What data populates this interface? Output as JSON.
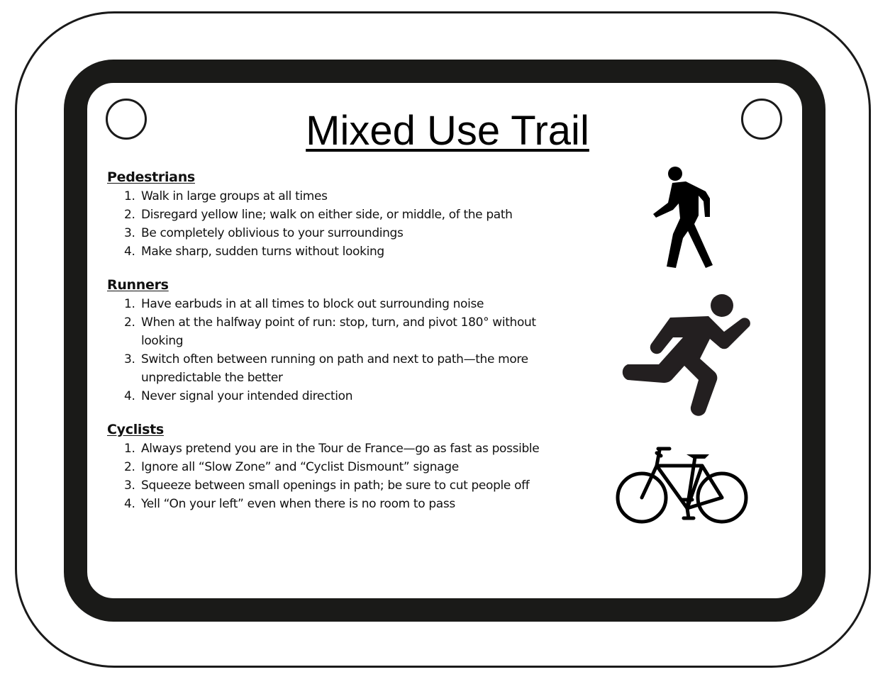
{
  "sign": {
    "title": "Mixed Use Trail",
    "sections": [
      {
        "heading": "Pedestrians",
        "icon": "pedestrian-icon",
        "rules": [
          {
            "num": "1.",
            "text": "Walk in large groups at all times"
          },
          {
            "num": "2.",
            "text": "Disregard yellow line; walk on either side, or middle, of the path"
          },
          {
            "num": "3.",
            "text": "Be completely oblivious to your surroundings"
          },
          {
            "num": "4.",
            "text": "Make sharp, sudden turns without looking"
          }
        ]
      },
      {
        "heading": "Runners",
        "icon": "runner-icon",
        "rules": [
          {
            "num": "1.",
            "text": "Have earbuds in at all times to block out surrounding noise"
          },
          {
            "num": "2.",
            "text": "When at the halfway point of run: stop, turn, and pivot 180° without looking"
          },
          {
            "num": "3.",
            "text": "Switch often between running on path and next to path—the more unpredictable the better"
          },
          {
            "num": "4.",
            "text": "Never signal your intended direction"
          }
        ]
      },
      {
        "heading": "Cyclists",
        "icon": "bicycle-icon",
        "rules": [
          {
            "num": "1.",
            "text": "Always pretend you are in the Tour de France—go as fast as possible"
          },
          {
            "num": "2.",
            "text": "Ignore all “Slow Zone” and “Cyclist Dismount” signage"
          },
          {
            "num": "3.",
            "text": "Squeeze between small openings in path; be sure to cut people off"
          },
          {
            "num": "4.",
            "text": "Yell “On your left” even when there is no room to pass"
          }
        ]
      }
    ],
    "colors": {
      "ink": "#1a1a18",
      "background": "#ffffff"
    }
  }
}
